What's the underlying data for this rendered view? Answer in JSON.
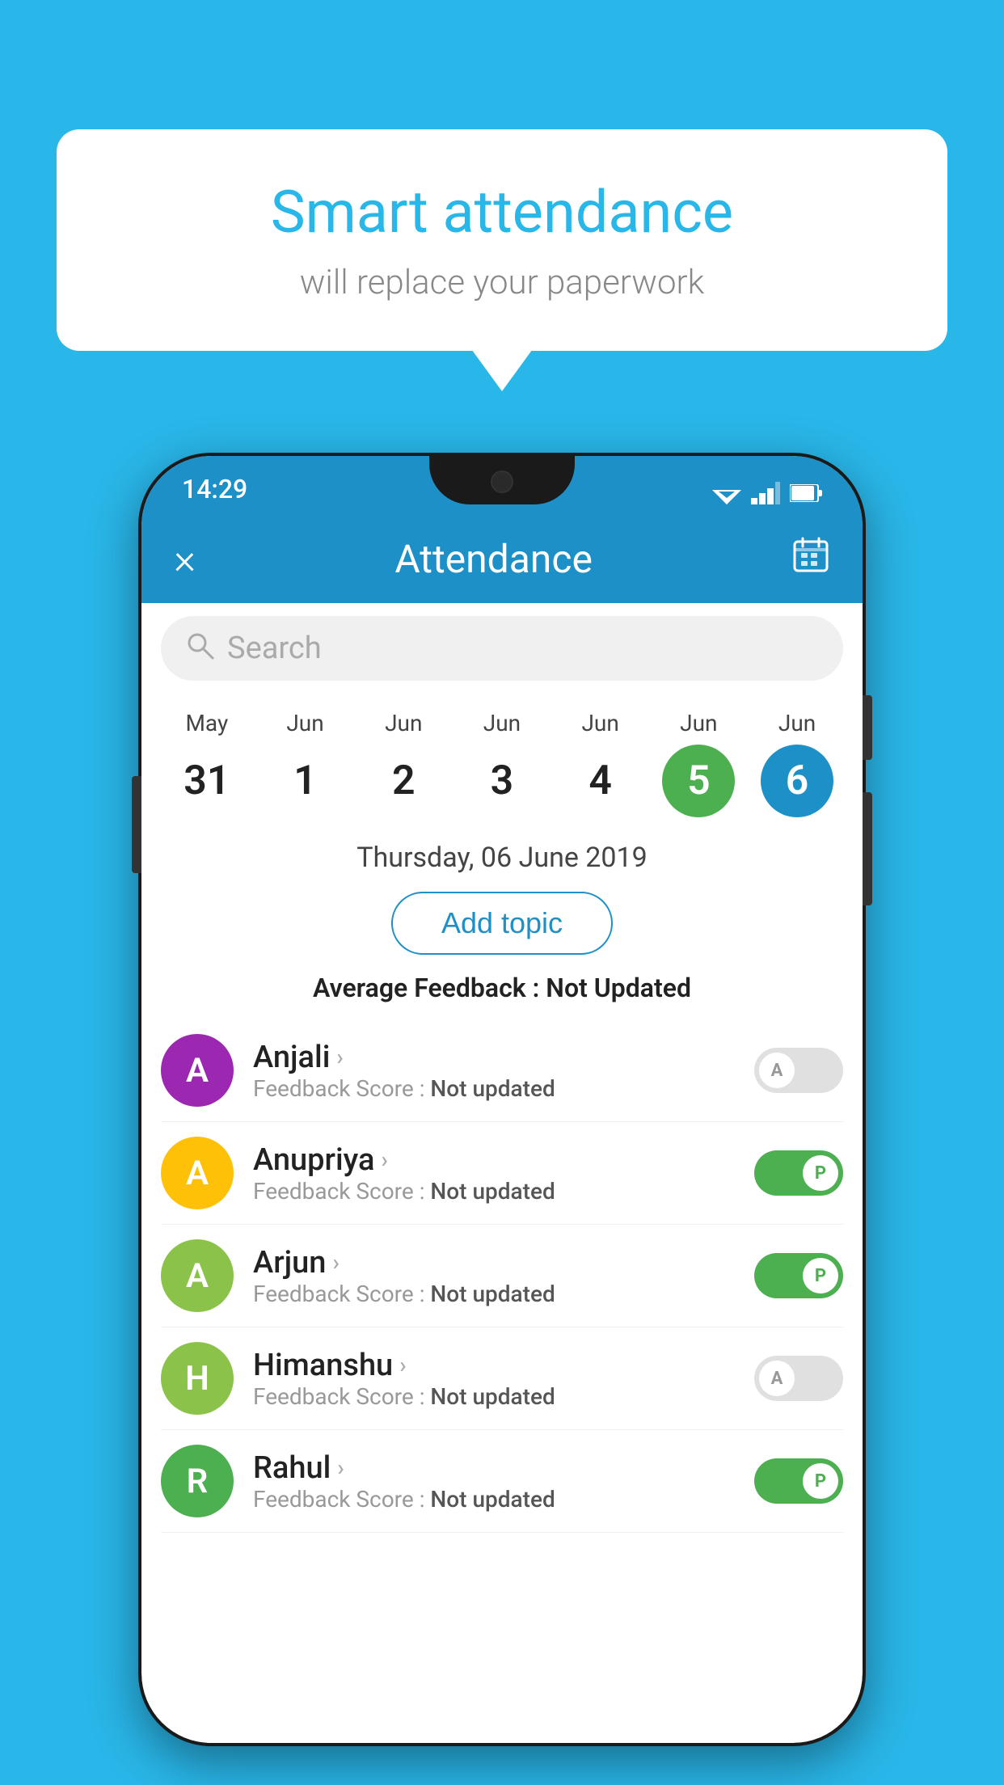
{
  "background_color": "#29b6e8",
  "speech_bubble": {
    "title": "Smart attendance",
    "subtitle": "will replace your paperwork"
  },
  "status_bar": {
    "time": "14:29"
  },
  "app_bar": {
    "title": "Attendance",
    "close_label": "×",
    "calendar_icon": "calendar"
  },
  "search": {
    "placeholder": "Search"
  },
  "calendar": {
    "days": [
      {
        "month": "May",
        "number": "31",
        "state": "normal"
      },
      {
        "month": "Jun",
        "number": "1",
        "state": "normal"
      },
      {
        "month": "Jun",
        "number": "2",
        "state": "normal"
      },
      {
        "month": "Jun",
        "number": "3",
        "state": "normal"
      },
      {
        "month": "Jun",
        "number": "4",
        "state": "normal"
      },
      {
        "month": "Jun",
        "number": "5",
        "state": "today"
      },
      {
        "month": "Jun",
        "number": "6",
        "state": "selected"
      }
    ]
  },
  "selected_date": "Thursday, 06 June 2019",
  "add_topic_label": "Add topic",
  "avg_feedback_label": "Average Feedback :",
  "avg_feedback_value": "Not Updated",
  "students": [
    {
      "name": "Anjali",
      "avatar_letter": "A",
      "avatar_color": "#9c27b0",
      "feedback_label": "Feedback Score :",
      "feedback_value": "Not updated",
      "toggle_state": "off",
      "toggle_letter": "A"
    },
    {
      "name": "Anupriya",
      "avatar_letter": "A",
      "avatar_color": "#ffc107",
      "feedback_label": "Feedback Score :",
      "feedback_value": "Not updated",
      "toggle_state": "on",
      "toggle_letter": "P"
    },
    {
      "name": "Arjun",
      "avatar_letter": "A",
      "avatar_color": "#8bc34a",
      "feedback_label": "Feedback Score :",
      "feedback_value": "Not updated",
      "toggle_state": "on",
      "toggle_letter": "P"
    },
    {
      "name": "Himanshu",
      "avatar_letter": "H",
      "avatar_color": "#8bc34a",
      "feedback_label": "Feedback Score :",
      "feedback_value": "Not updated",
      "toggle_state": "off",
      "toggle_letter": "A"
    },
    {
      "name": "Rahul",
      "avatar_letter": "R",
      "avatar_color": "#4caf50",
      "feedback_label": "Feedback Score :",
      "feedback_value": "Not updated",
      "toggle_state": "on",
      "toggle_letter": "P"
    }
  ]
}
